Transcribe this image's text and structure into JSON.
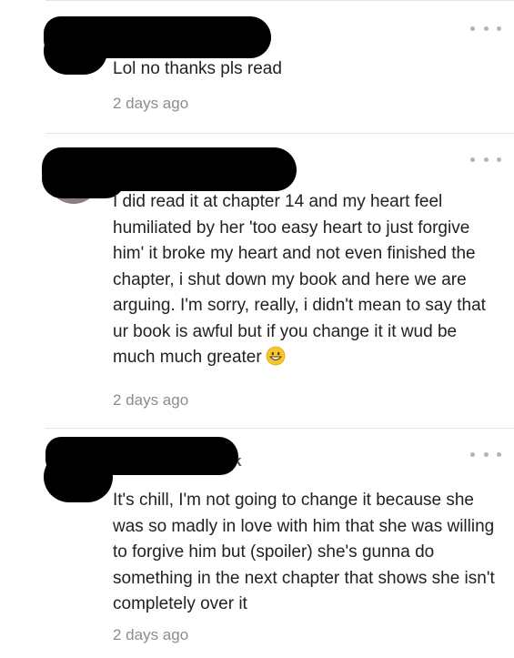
{
  "comments": [
    {
      "text": "Lol no thanks pls read",
      "time": "2 days ago"
    },
    {
      "text": "I did read it at chapter 14 and my heart feel humiliated by her 'too easy heart to just forgive him' it broke my heart and not even finished the chapter, i shut down my book and here we are arguing. I'm sorry, really, i didn't mean to say that ur book is awful but if you change it it wud be much much greater",
      "emoji": "grinning-face",
      "time": "2 days ago"
    },
    {
      "username_fragment": "k",
      "text": "It's chill, I'm not going to change it because she was so madly in love with him that she was willing to forgive him but (spoiler) she's gunna do something in the next chapter that shows she isn't completely over it",
      "time": "2 days ago"
    }
  ],
  "colors": {
    "text": "#222222",
    "timestamp": "#8c8c8c",
    "divider": "#e6e6e6",
    "more_dots": "#b3b3b3",
    "redaction": "#000000"
  }
}
